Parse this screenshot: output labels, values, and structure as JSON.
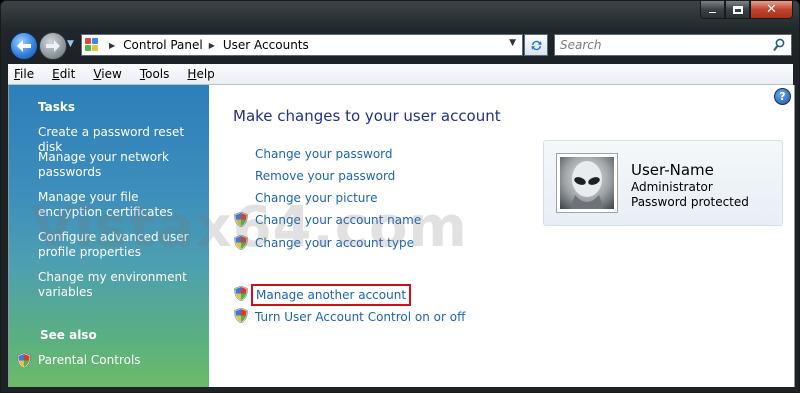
{
  "window": {
    "caption_buttons": [
      "minimize",
      "maximize",
      "close"
    ]
  },
  "address_bar": {
    "breadcrumb": [
      "Control Panel",
      "User Accounts"
    ]
  },
  "search": {
    "placeholder": "Search"
  },
  "menu": [
    {
      "label": "File",
      "mnemonic": "F"
    },
    {
      "label": "Edit",
      "mnemonic": "E"
    },
    {
      "label": "View",
      "mnemonic": "V"
    },
    {
      "label": "Tools",
      "mnemonic": "T"
    },
    {
      "label": "Help",
      "mnemonic": "H"
    }
  ],
  "sidebar": {
    "tasks_heading": "Tasks",
    "tasks": [
      "Create a password reset disk",
      "Manage your network passwords",
      "Manage your file encryption certificates",
      "Configure advanced user profile properties",
      "Change my environment variables"
    ],
    "see_also_heading": "See also",
    "see_also": [
      "Parental Controls"
    ]
  },
  "main": {
    "title": "Make changes to your user account",
    "links": [
      "Change your password",
      "Remove your password",
      "Change your picture",
      "Change your account name",
      "Change your account type"
    ],
    "links2": [
      "Manage another account",
      "Turn User Account Control on or off"
    ]
  },
  "user": {
    "name": "User-Name",
    "role": "Administrator",
    "status": "Password protected"
  },
  "watermark": "Vistax64.com",
  "colors": {
    "link": "#1e64b4",
    "title": "#1e3287",
    "highlight": "#d0101c"
  }
}
